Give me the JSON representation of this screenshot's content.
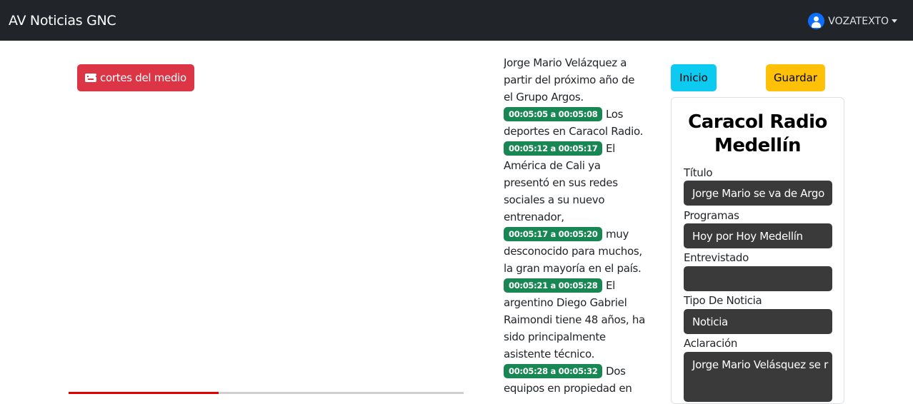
{
  "app": {
    "brand": "AV Noticias GNC"
  },
  "user": {
    "name": "VOZATEXTO"
  },
  "media": {
    "cortes_label": "cortes del medio",
    "progress_percent": 38
  },
  "transcript": {
    "lead_text": "Jorge Mario Velázquez a partir del próximo año de el Grupo Argos.",
    "segments": [
      {
        "time": "00:05:05 a 00:05:08",
        "text": "Los deportes en Caracol Radio."
      },
      {
        "time": "00:05:12 a 00:05:17",
        "text": "El América de Cali ya presentó en sus redes sociales a su nuevo entrenador,"
      },
      {
        "time": "00:05:17 a 00:05:20",
        "text": "muy desconocido para muchos, la gran mayoría en el país."
      },
      {
        "time": "00:05:21 a 00:05:28",
        "text": "El argentino Diego Gabriel Raimondi tiene 48 años, ha sido principalmente asistente técnico."
      },
      {
        "time": "00:05:28 a 00:05:32",
        "text": "Dos equipos en propiedad en"
      }
    ]
  },
  "actions": {
    "inicio_label": "Inicio",
    "guardar_label": "Guardar"
  },
  "form": {
    "station": "Caracol Radio Medellín",
    "fields": [
      {
        "label": "Título",
        "value": "Jorge Mario se va de Argo"
      },
      {
        "label": "Programas",
        "value": "Hoy por Hoy Medellín"
      },
      {
        "label": "Entrevistado",
        "value": ""
      },
      {
        "label": "Tipo De Noticia",
        "value": "Noticia"
      },
      {
        "label": "Aclaración",
        "value": "Jorge Mario Velásquez se r"
      }
    ]
  },
  "colors": {
    "navbar": "#212529",
    "danger": "#dc3545",
    "info": "#0dcaf0",
    "warning": "#ffc107",
    "success": "#198754",
    "field_bg": "#3a3a3a"
  }
}
